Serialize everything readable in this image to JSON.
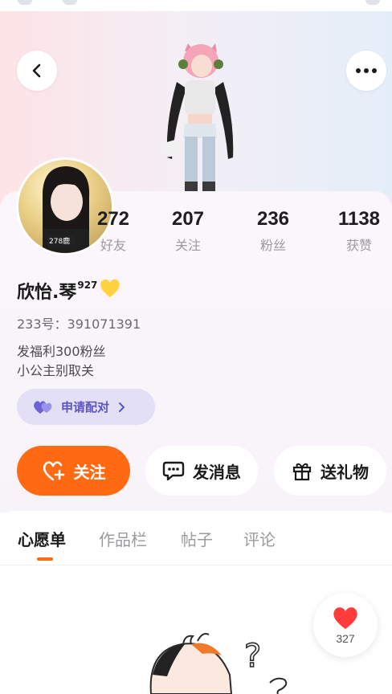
{
  "header": {
    "back_icon": "chevron-left-icon",
    "more_icon": "more-dots-icon"
  },
  "stats": [
    {
      "value": "272",
      "label": "好友"
    },
    {
      "value": "207",
      "label": "关注"
    },
    {
      "value": "236",
      "label": "粉丝"
    },
    {
      "value": "1138",
      "label": "获赞"
    }
  ],
  "profile": {
    "name": "欣怡.琴",
    "name_sup": "927",
    "badge_icon": "yellow-heart-icon",
    "id_label": "233号：391071391",
    "bio_line1": "发福利300粉丝",
    "bio_line2": "小公主别取关",
    "avatar_caption": "278鹿"
  },
  "pair_chip": {
    "label": "申请配对"
  },
  "actions": {
    "follow": "关注",
    "message": "发消息",
    "gift": "送礼物"
  },
  "tabs": [
    {
      "label": "心愿单",
      "active": true
    },
    {
      "label": "作品栏",
      "active": false
    },
    {
      "label": "帖子",
      "active": false
    },
    {
      "label": "评论",
      "active": false
    }
  ],
  "like": {
    "count": "327"
  },
  "colors": {
    "accent": "#ff6a13",
    "pair_chip_bg": "#e3e0f6",
    "pair_chip_text": "#5c55c4",
    "like_heart": "#ff3b3b"
  }
}
